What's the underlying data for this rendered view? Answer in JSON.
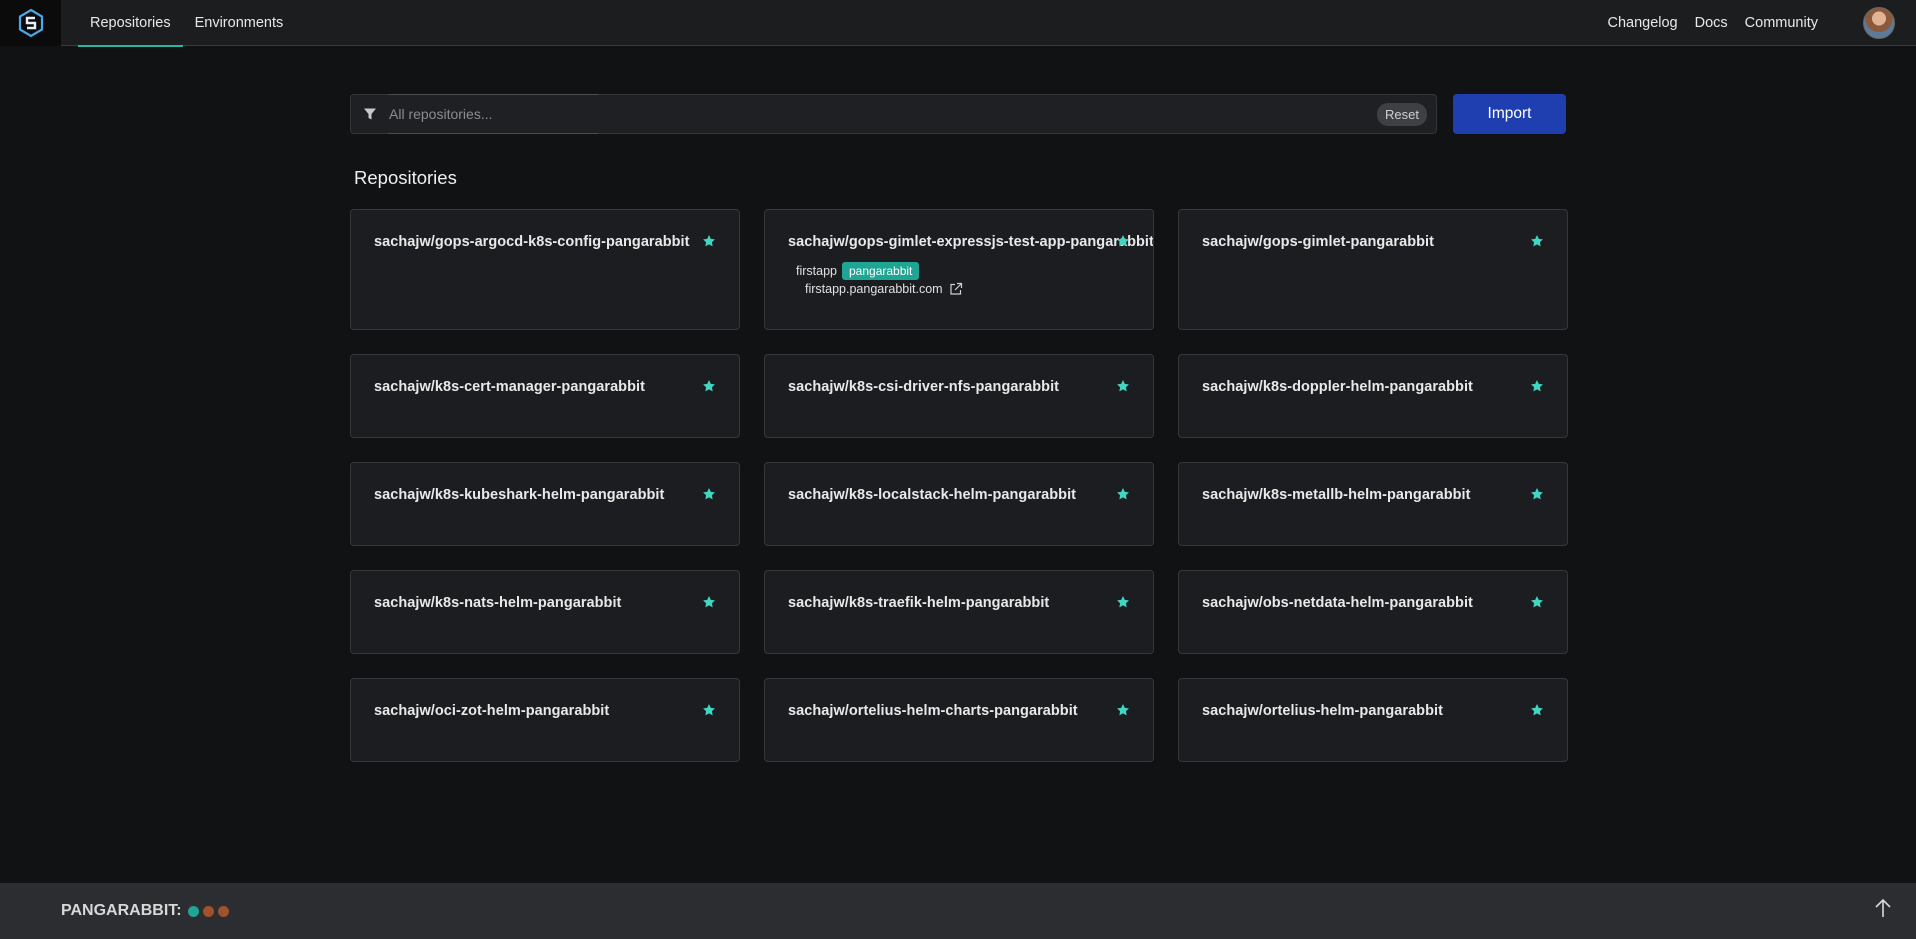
{
  "nav": {
    "tabs": [
      {
        "label": "Repositories",
        "active": true
      },
      {
        "label": "Environments",
        "active": false
      }
    ],
    "links": [
      "Changelog",
      "Docs",
      "Community"
    ]
  },
  "search": {
    "placeholder": "All repositories...",
    "value": "",
    "reset_label": "Reset"
  },
  "import_label": "Import",
  "section_title": "Repositories",
  "repositories": [
    {
      "name": "sachajw/gops-argocd-k8s-config-pangarabbit",
      "starred": true
    },
    {
      "name": "sachajw/gops-gimlet-expressjs-test-app-pangarabbit",
      "starred": true,
      "environment": {
        "name": "firstapp",
        "badge": "pangarabbit",
        "url": "firstapp.pangarabbit.com"
      }
    },
    {
      "name": "sachajw/gops-gimlet-pangarabbit",
      "starred": true
    },
    {
      "name": "sachajw/k8s-cert-manager-pangarabbit",
      "starred": true
    },
    {
      "name": "sachajw/k8s-csi-driver-nfs-pangarabbit",
      "starred": true
    },
    {
      "name": "sachajw/k8s-doppler-helm-pangarabbit",
      "starred": true
    },
    {
      "name": "sachajw/k8s-kubeshark-helm-pangarabbit",
      "starred": true
    },
    {
      "name": "sachajw/k8s-localstack-helm-pangarabbit",
      "starred": true
    },
    {
      "name": "sachajw/k8s-metallb-helm-pangarabbit",
      "starred": true
    },
    {
      "name": "sachajw/k8s-nats-helm-pangarabbit",
      "starred": true
    },
    {
      "name": "sachajw/k8s-traefik-helm-pangarabbit",
      "starred": true
    },
    {
      "name": "sachajw/obs-netdata-helm-pangarabbit",
      "starred": true
    },
    {
      "name": "sachajw/oci-zot-helm-pangarabbit",
      "starred": true
    },
    {
      "name": "sachajw/ortelius-helm-charts-pangarabbit",
      "starred": true
    },
    {
      "name": "sachajw/ortelius-helm-pangarabbit",
      "starred": true
    }
  ],
  "footer": {
    "brand": "PANGARABBIT:",
    "status_dots": [
      "#1ea593",
      "#a0522d",
      "#a0522d"
    ]
  },
  "colors": {
    "accent": "#2bb5a3",
    "star": "#3fd6c2",
    "import_button": "#1f3fb0",
    "badge": "#1ea593"
  },
  "icons": {
    "logo": "logo-icon",
    "filter": "filter-icon",
    "star": "star-icon",
    "external_link": "external-link-icon",
    "scroll_top": "arrow-up-icon"
  }
}
